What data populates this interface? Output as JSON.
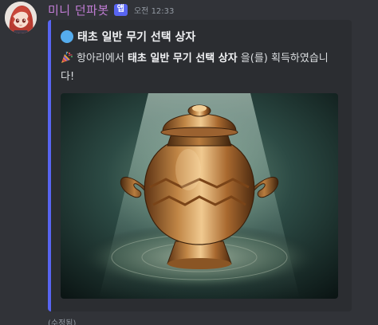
{
  "author": {
    "name": "미니 던파봇",
    "badge": "앱",
    "timestamp": "오전 12:33",
    "avatar_icon": "anime-girl-avatar-icon"
  },
  "embed": {
    "accent_color": "#5865f2",
    "title_icon": "blue-circle-icon",
    "title": "태초 일반 무기 선택 상자",
    "description": {
      "icon": "party-popper-icon",
      "prefix": "항아리에서 ",
      "item": "태초 일반 무기 선택 상자",
      "suffix": " 을(를) 획득하였습니다!"
    },
    "image_icon": "golden-pot-image"
  },
  "edited_label": "(수정됨)"
}
